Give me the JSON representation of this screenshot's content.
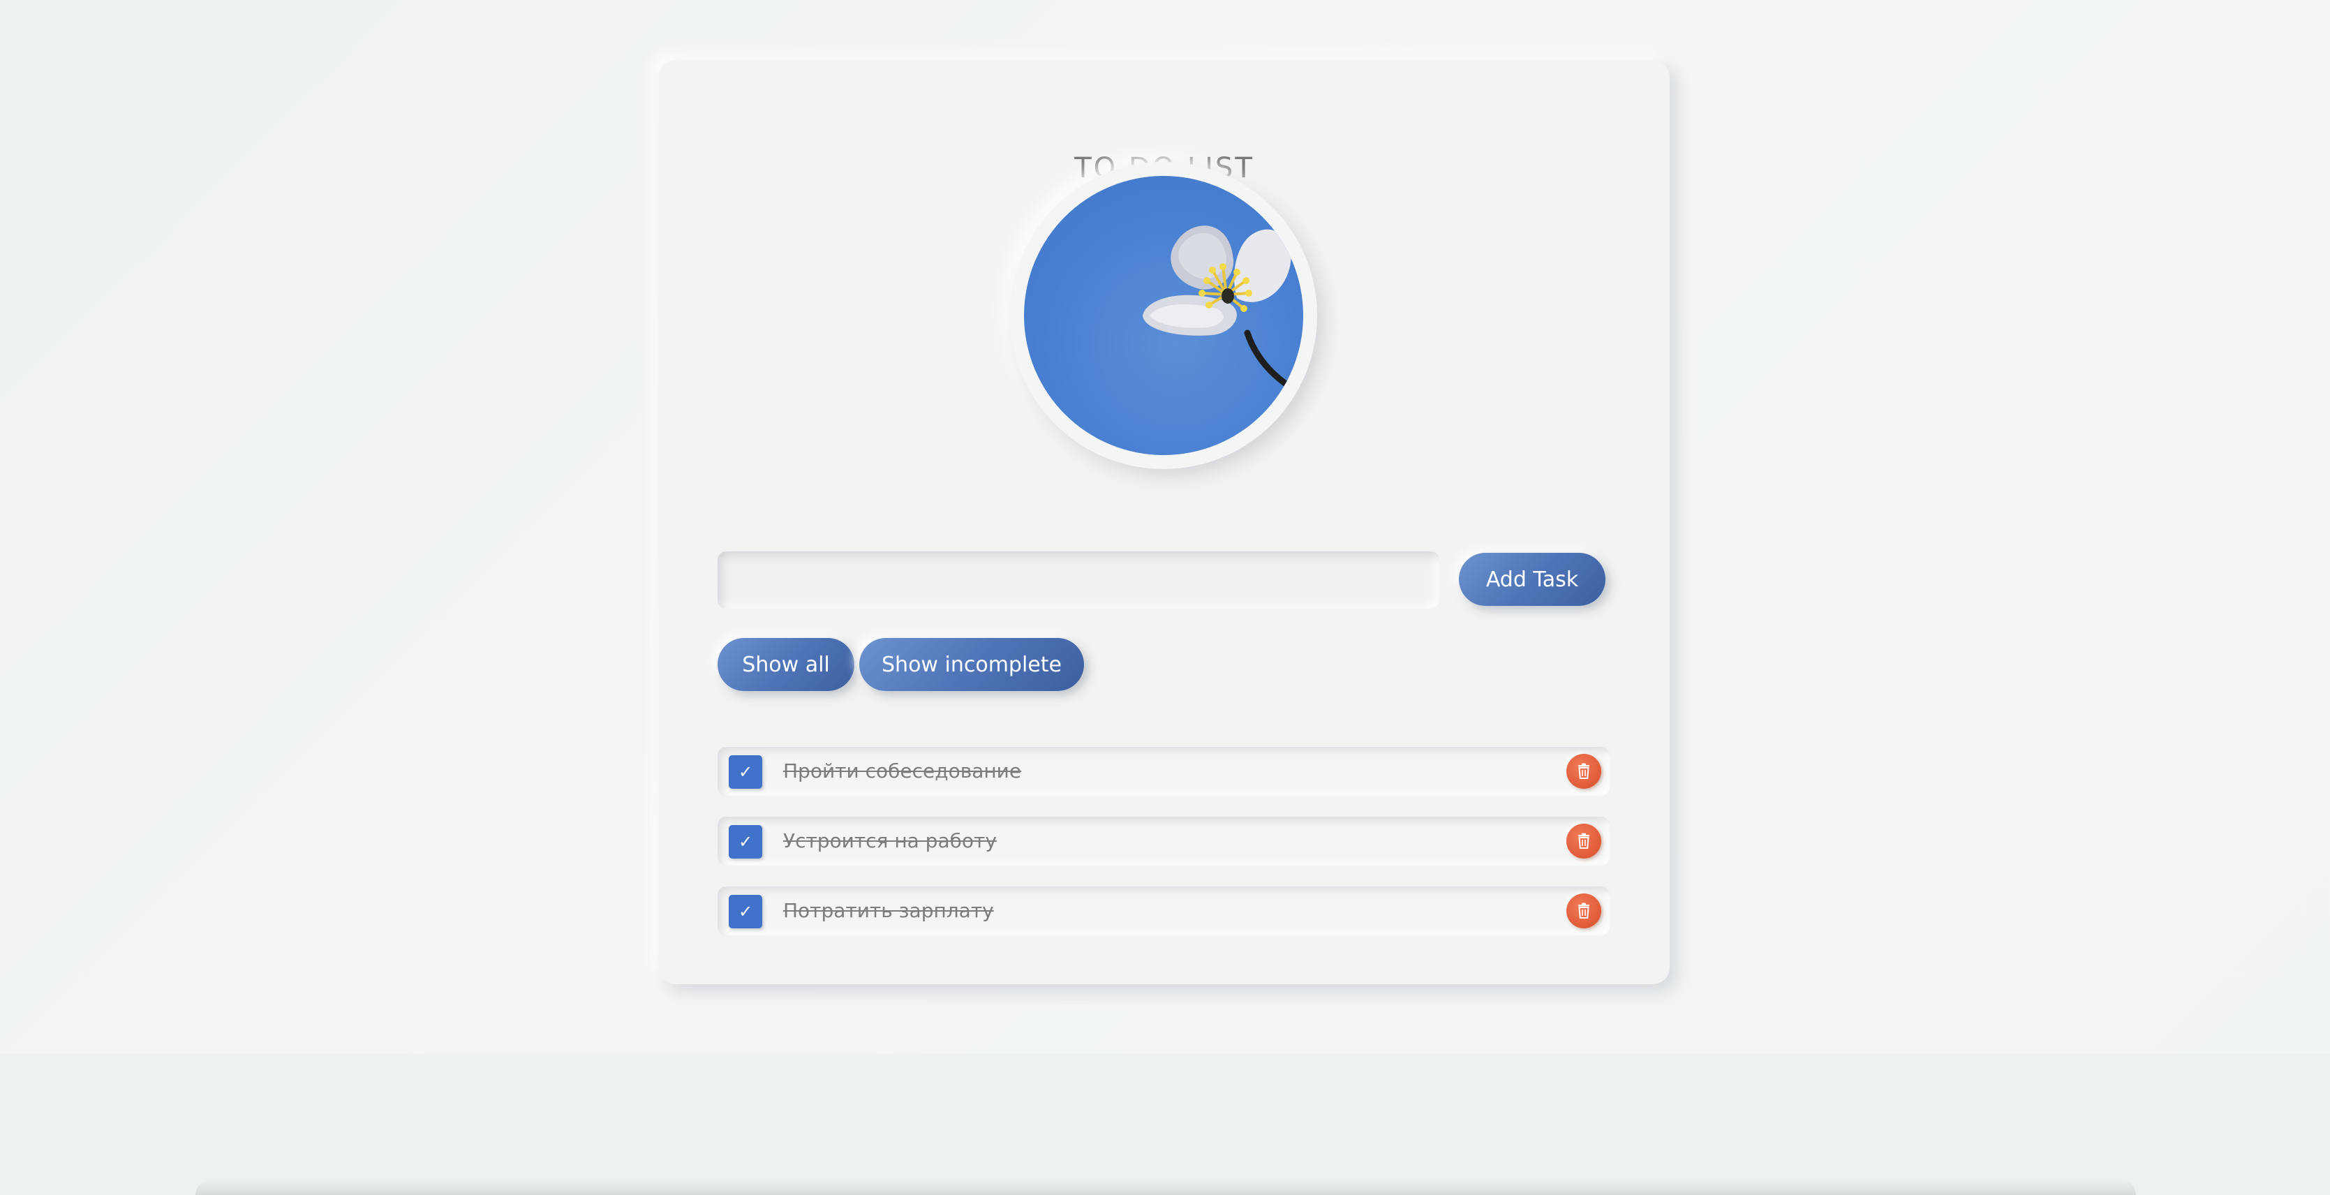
{
  "app": {
    "title": "TO DO LIST"
  },
  "input": {
    "value": "",
    "placeholder": ""
  },
  "buttons": {
    "add_task": "Add Task",
    "show_all": "Show all",
    "show_incomplete": "Show incomplete"
  },
  "tasks": [
    {
      "text": "Пройти собеседование",
      "completed": true,
      "check_glyph": "✓"
    },
    {
      "text": "Устроится на работу",
      "completed": true,
      "check_glyph": "✓"
    },
    {
      "text": "Потратить зарплату",
      "completed": true,
      "check_glyph": "✓"
    }
  ],
  "icons": {
    "task_delete": "trash-icon",
    "task_check": "check-icon",
    "avatar": "flower-photo"
  },
  "colors": {
    "accent_blue": "#4f75b8",
    "checkbox_blue": "#3f72c8",
    "delete_orange": "#e35f3c",
    "card_bg": "#f2f3f3",
    "title_gray": "#777777",
    "task_text_gray": "#7d7d7d"
  }
}
